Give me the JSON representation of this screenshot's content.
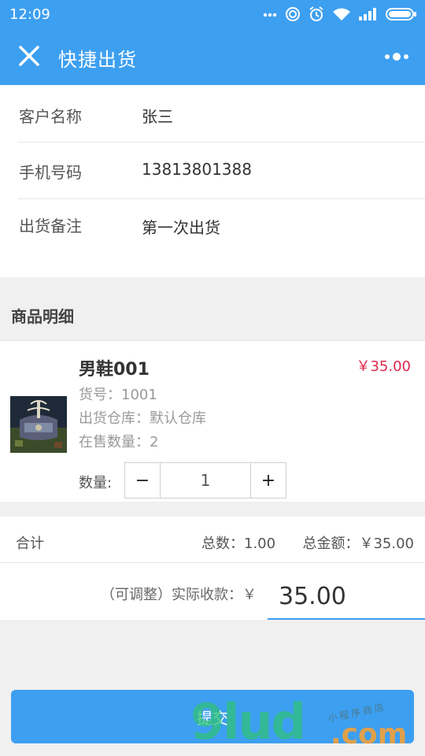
{
  "statusbar": {
    "time": "12:09",
    "icons": [
      "dots-icon",
      "target-icon",
      "alarm-icon",
      "wifi-icon",
      "signal-icon",
      "battery-icon"
    ]
  },
  "header": {
    "title": "快捷出货",
    "close_icon": "close-icon",
    "more_icon": "more-icon"
  },
  "form": {
    "customer_label": "客户名称",
    "customer_value": "张三",
    "phone_label": "手机号码",
    "phone_value": "13813801388",
    "note_label": "出货备注",
    "note_value": "第一次出货"
  },
  "section": {
    "title": "商品明细"
  },
  "product": {
    "name": "男鞋001",
    "price": "￥35.00",
    "sku": "货号：1001",
    "warehouse": "出货仓库：默认仓库",
    "on_sale": "在售数量：2",
    "qty_label": "数量:",
    "qty_value": "1",
    "minus": "−",
    "plus": "+"
  },
  "totals": {
    "label": "合计",
    "count": "总数：1.00",
    "amount": "总金额：￥35.00"
  },
  "actual": {
    "label": "（可调整）实际收款：￥",
    "value": "35.00"
  },
  "submit": {
    "label": "提交"
  },
  "watermark": {
    "main": "9lud",
    "suffix": ".com",
    "small": "小程序商店"
  },
  "colors": {
    "accent": "#3d9ff0",
    "price": "#e0284b"
  }
}
